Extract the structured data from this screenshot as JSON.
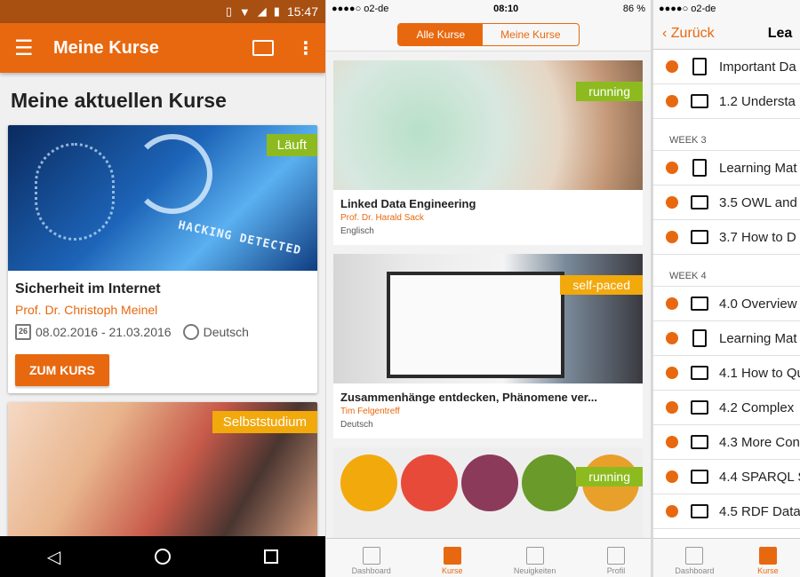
{
  "android": {
    "status_time": "15:47",
    "app_title": "Meine Kurse",
    "heading": "Meine aktuellen Kurse",
    "card1": {
      "badge": "Läuft",
      "title": "Sicherheit im Internet",
      "prof": "Prof. Dr. Christoph Meinel",
      "dates": "08.02.2016 - 21.03.2016",
      "cal_day": "26",
      "language": "Deutsch",
      "image_text": "HACKING DETECTED",
      "button": "ZUM KURS"
    },
    "card2": {
      "badge": "Selbststudium"
    }
  },
  "ios1": {
    "carrier": "●●●●○ o2-de",
    "time": "08:10",
    "battery": "86 %",
    "seg_all": "Alle Kurse",
    "seg_mine": "Meine Kurse",
    "courses": [
      {
        "badge": "running",
        "title": "Linked Data Engineering",
        "prof": "Prof. Dr. Harald Sack",
        "lang": "Englisch"
      },
      {
        "badge": "self-paced",
        "title": "Zusammenhänge entdecken, Phänomene ver...",
        "prof": "Tim Felgentreff",
        "lang": "Deutsch"
      },
      {
        "badge": "running"
      }
    ],
    "tabs": [
      "Dashboard",
      "Kurse",
      "Neuigkeiten",
      "Profil"
    ]
  },
  "ios2": {
    "carrier": "●●●●○ o2-de",
    "back": "Zurück",
    "title": "Lea",
    "items_top": [
      "Important Da",
      "1.2 Understa"
    ],
    "week3": "WEEK 3",
    "items_w3": [
      "Learning Mat",
      "3.5 OWL and",
      "3.7 How to D"
    ],
    "week4": "WEEK 4",
    "items_w4": [
      "4.0 Overview",
      "Learning Mat",
      "4.1 How to Qu",
      "4.2 Complex",
      "4.3 More Con",
      "4.4 SPARQL S",
      "4.5 RDF Data"
    ],
    "tabs": [
      "Dashboard",
      "Kurse"
    ]
  }
}
